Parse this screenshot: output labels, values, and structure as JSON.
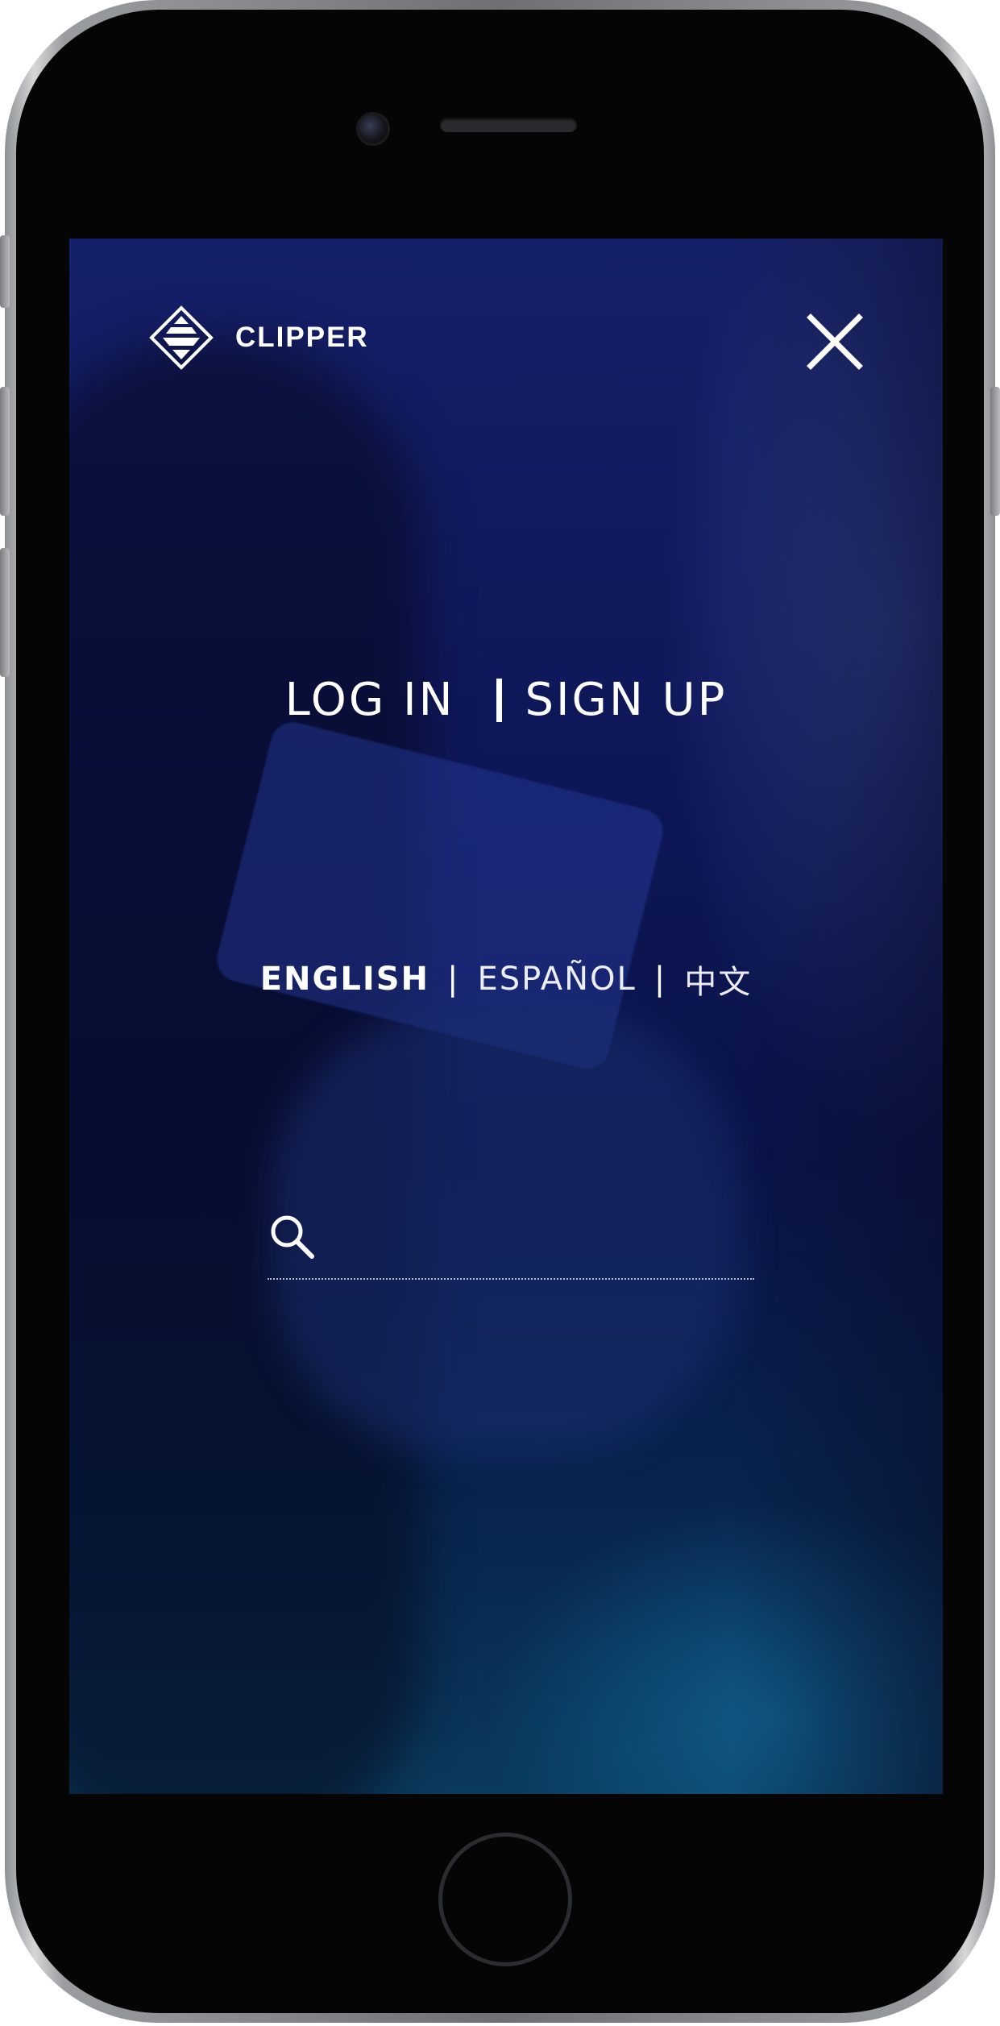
{
  "header": {
    "brand_name": "CLIPPER",
    "logo_icon": "clipper-logo-icon",
    "close_icon": "close-icon"
  },
  "auth": {
    "login_label": "LOG IN",
    "signup_label": "SIGN UP"
  },
  "languages": {
    "items": [
      {
        "label": "ENGLISH",
        "active": true
      },
      {
        "label": "ESPAÑOL",
        "active": false
      },
      {
        "label": "中文",
        "active": false
      }
    ],
    "separator": "|"
  },
  "search": {
    "icon": "search-icon",
    "value": "",
    "placeholder": ""
  },
  "colors": {
    "overlay": "#0b1447",
    "text": "#ffffff",
    "device_frame": "#050505"
  }
}
